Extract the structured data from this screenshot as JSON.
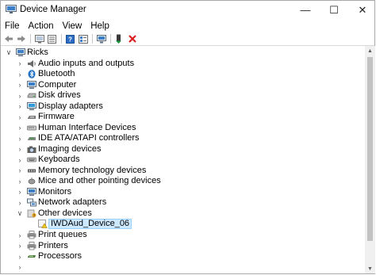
{
  "window": {
    "title": "Device Manager"
  },
  "title_buttons": {
    "minimize": "—",
    "maximize": "☐",
    "close": "✕"
  },
  "menu": [
    "File",
    "Action",
    "View",
    "Help"
  ],
  "toolbar": [
    "back-arrow-icon",
    "forward-arrow-icon",
    "computer-view-icon",
    "properties-icon",
    "help-icon",
    "device-list-icon",
    "scan-hardware-icon",
    "enable-device-icon",
    "uninstall-icon"
  ],
  "tree": {
    "root": "Ricks",
    "categories": [
      {
        "label": "Audio inputs and outputs",
        "icon": "speaker-icon"
      },
      {
        "label": "Bluetooth",
        "icon": "bluetooth-icon"
      },
      {
        "label": "Computer",
        "icon": "monitor-icon"
      },
      {
        "label": "Disk drives",
        "icon": "disk-drive-icon"
      },
      {
        "label": "Display adapters",
        "icon": "display-adapter-icon"
      },
      {
        "label": "Firmware",
        "icon": "firmware-icon"
      },
      {
        "label": "Human Interface Devices",
        "icon": "hid-icon"
      },
      {
        "label": "IDE ATA/ATAPI controllers",
        "icon": "ide-controller-icon"
      },
      {
        "label": "Imaging devices",
        "icon": "camera-icon"
      },
      {
        "label": "Keyboards",
        "icon": "keyboard-icon"
      },
      {
        "label": "Memory technology devices",
        "icon": "memory-icon"
      },
      {
        "label": "Mice and other pointing devices",
        "icon": "mouse-icon"
      },
      {
        "label": "Monitors",
        "icon": "monitor-icon"
      },
      {
        "label": "Network adapters",
        "icon": "network-icon"
      },
      {
        "label": "Other devices",
        "icon": "unknown-device-icon"
      },
      {
        "label": "Print queues",
        "icon": "printer-icon"
      },
      {
        "label": "Printers",
        "icon": "printer-icon"
      },
      {
        "label": "Processors",
        "icon": "processor-icon"
      }
    ],
    "expanded_child": {
      "label": "IWDAud_Device_06",
      "icon": "warning-device-icon"
    }
  },
  "colors": {
    "selection_bg": "#cce8ff",
    "selection_border": "#99d1ff",
    "accent_blue": "#1e6fc6",
    "uninstall_red": "#d81e1e"
  }
}
